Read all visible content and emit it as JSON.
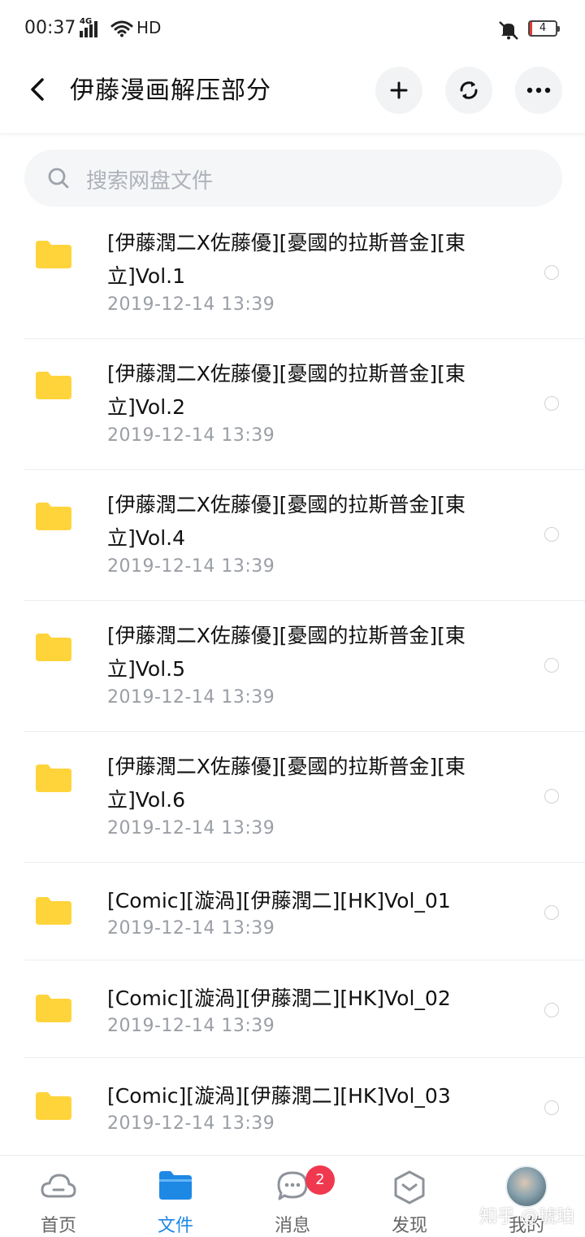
{
  "status_bar": {
    "time": "00:37",
    "network": "4G",
    "hd": "HD",
    "battery": "4"
  },
  "header": {
    "title": "伊藤漫画解压部分",
    "add_icon": "plus-icon",
    "refresh_icon": "refresh-icon",
    "more_icon": "more-icon"
  },
  "search": {
    "placeholder": "搜索网盘文件"
  },
  "files": [
    {
      "name": "[伊藤潤二X佐藤優][憂國的拉斯普金][東立]Vol.1",
      "date": "2019-12-14  13:39"
    },
    {
      "name": "[伊藤潤二X佐藤優][憂國的拉斯普金][東立]Vol.2",
      "date": "2019-12-14  13:39"
    },
    {
      "name": "[伊藤潤二X佐藤優][憂國的拉斯普金][東立]Vol.4",
      "date": "2019-12-14  13:39"
    },
    {
      "name": "[伊藤潤二X佐藤優][憂國的拉斯普金][東立]Vol.5",
      "date": "2019-12-14  13:39"
    },
    {
      "name": "[伊藤潤二X佐藤優][憂國的拉斯普金][東立]Vol.6",
      "date": "2019-12-14  13:39"
    },
    {
      "name": "[Comic][漩渦][伊藤潤二][HK]Vol_01",
      "date": "2019-12-14  13:39"
    },
    {
      "name": "[Comic][漩渦][伊藤潤二][HK]Vol_02",
      "date": "2019-12-14  13:39"
    },
    {
      "name": "[Comic][漩渦][伊藤潤二][HK]Vol_03",
      "date": "2019-12-14  13:39"
    }
  ],
  "bottom_nav": {
    "tabs": [
      {
        "label": "首页",
        "icon": "cloud-icon"
      },
      {
        "label": "文件",
        "icon": "folder-icon"
      },
      {
        "label": "消息",
        "icon": "message-icon",
        "badge": "2"
      },
      {
        "label": "发现",
        "icon": "discover-icon"
      },
      {
        "label": "我的",
        "icon": "avatar"
      }
    ],
    "active": "文件"
  },
  "watermark": "知乎 @琥珀",
  "colors": {
    "accent": "#1e88e5",
    "folder": "#ffd43b",
    "badge": "#f0384f"
  }
}
